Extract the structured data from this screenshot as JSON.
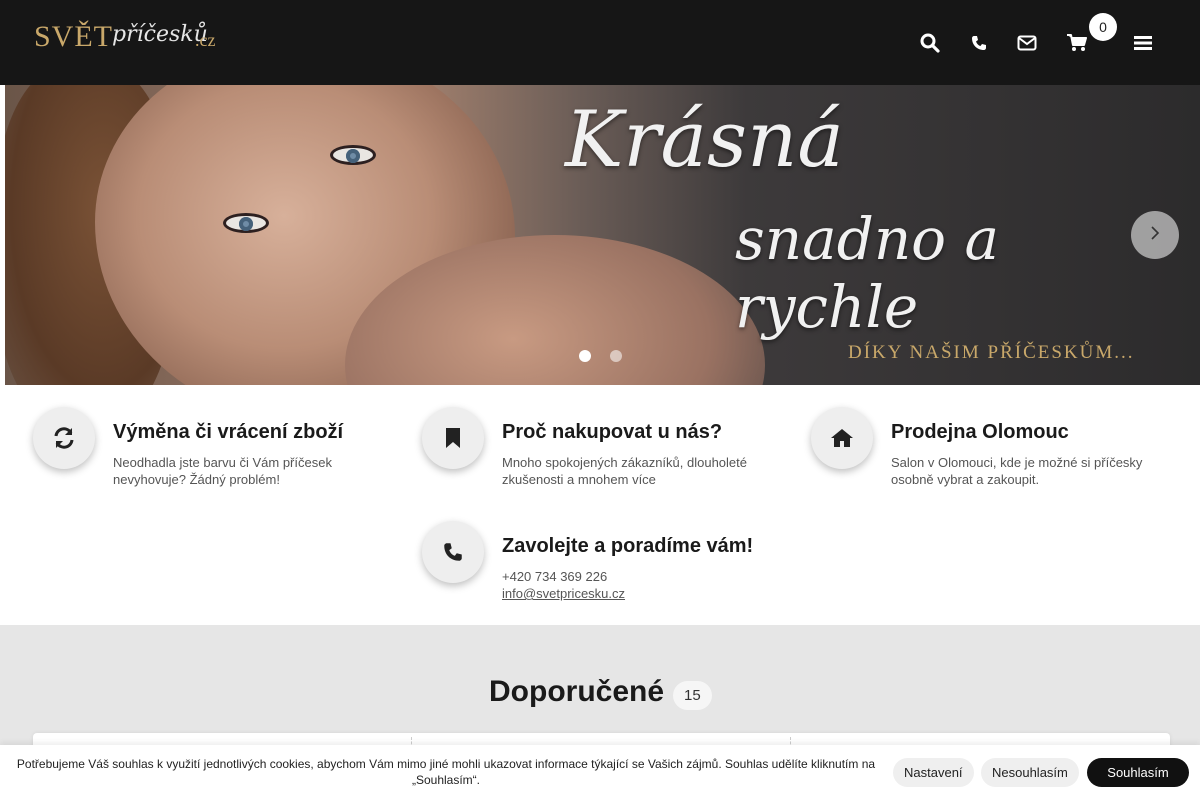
{
  "header": {
    "logo": {
      "main": "SVĚT",
      "script": "příčesků",
      "tld": ".cz"
    },
    "cart_count": "0",
    "icons": [
      "search-icon",
      "phone-icon",
      "envelope-icon",
      "cart-icon",
      "menu-icon"
    ]
  },
  "hero": {
    "title": "Krásná",
    "subtitle": "snadno a rychle",
    "tagline": "DÍKY NAŠIM PŘÍČESKŮM...",
    "active_slide": 1,
    "slide_count": 2
  },
  "features": [
    {
      "icon": "refresh-icon",
      "title": "Výměna či vrácení zboží",
      "text": "Neodhadla jste barvu či Vám příčesek nevyhovuje? Žádný problém!"
    },
    {
      "icon": "bookmark-icon",
      "title": "Proč nakupovat u nás?",
      "text": "Mnoho spokojených zákazníků, dlouholeté zkušenosti a mnohem více"
    },
    {
      "icon": "home-icon",
      "title": "Prodejna Olomouc",
      "text": "Salon v Olomouci, kde je možné si příčesky osobně vybrat a zakoupit."
    },
    {
      "icon": "phone-icon",
      "title": "Zavolejte a poradíme vám!",
      "phone": "+420 734 369 226",
      "email": "info@svetpricesku.cz"
    }
  ],
  "recommended": {
    "title": "Doporučené",
    "count": "15"
  },
  "cookie": {
    "text": "Potřebujeme Váš souhlas k využití jednotlivých cookies, abychom Vám mimo jiné mohli ukazovat informace týkající se Vašich zájmů. Souhlas udělíte kliknutím na „Souhlasím“.",
    "settings_label": "Nastavení",
    "decline_label": "Nesouhlasím",
    "accept_label": "Souhlasím"
  },
  "colors": {
    "header_bg": "#161616",
    "gold": "#c9a86a",
    "section_bg": "#e6e6e6",
    "accept_btn": "#111111"
  }
}
